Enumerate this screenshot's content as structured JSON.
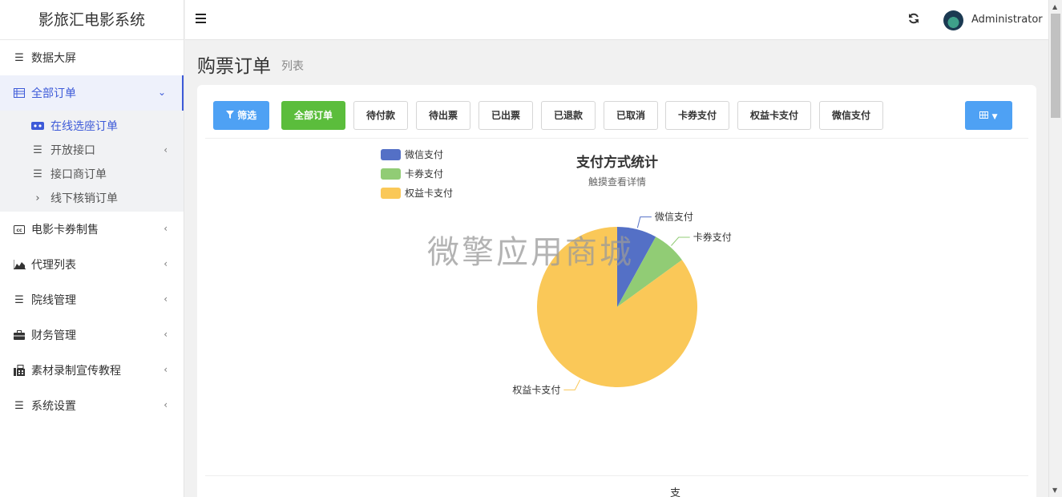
{
  "brand": "影旅汇电影系统",
  "sidebar": {
    "items": [
      {
        "label": "数据大屏"
      },
      {
        "label": "全部订单"
      },
      {
        "label": "电影卡券制售"
      },
      {
        "label": "代理列表"
      },
      {
        "label": "院线管理"
      },
      {
        "label": "财务管理"
      },
      {
        "label": "素材录制宣传教程"
      },
      {
        "label": "系统设置"
      }
    ],
    "sub_items": [
      {
        "label": "在线选座订单"
      },
      {
        "label": "开放接口"
      },
      {
        "label": "接口商订单"
      },
      {
        "label": "线下核销订单"
      }
    ]
  },
  "header": {
    "user": "Administrator"
  },
  "page": {
    "title": "购票订单",
    "subtitle": "列表"
  },
  "toolbar": {
    "filter": "筛选",
    "tabs": [
      "全部订单",
      "待付款",
      "待出票",
      "已出票",
      "已退款",
      "已取消",
      "卡券支付",
      "权益卡支付",
      "微信支付"
    ]
  },
  "watermark": "微擎应用商城",
  "footer_text": "支",
  "chart_data": {
    "type": "pie",
    "title": "支付方式统计",
    "subtitle": "触摸查看详情",
    "legend_position": "top-left",
    "slices": [
      {
        "name": "微信支付",
        "value": 8,
        "color": "#5470c6"
      },
      {
        "name": "卡券支付",
        "value": 7,
        "color": "#91cc75"
      },
      {
        "name": "权益卡支付",
        "value": 85,
        "color": "#fac858"
      }
    ]
  }
}
